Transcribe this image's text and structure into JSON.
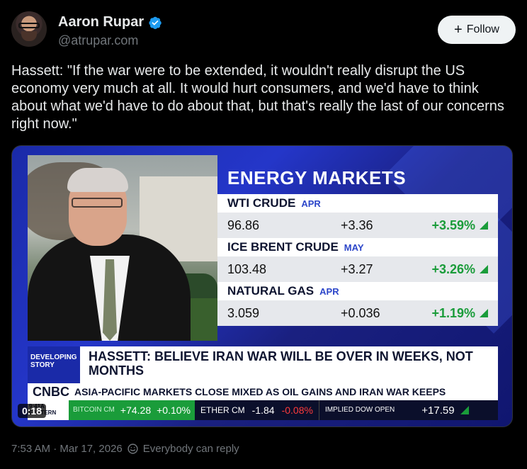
{
  "author": {
    "name": "Aaron Rupar",
    "handle": "@atrupar.com",
    "verified": true
  },
  "follow_button": {
    "label": "Follow",
    "icon": "plus-icon"
  },
  "post": {
    "text": "Hassett: \"If the war were to be extended, it wouldn't really disrupt the US economy very much at all. It would hurt consumers, and we'd have to think about what we'd have to do about that, but that's really the last of our concerns right now.\""
  },
  "video": {
    "duration": "0:18",
    "panel_title": "ENERGY MARKETS",
    "markets": [
      {
        "name": "WTI CRUDE",
        "month": "APR",
        "price": "96.86",
        "change": "+3.36",
        "pct": "+3.59%"
      },
      {
        "name": "ICE BRENT CRUDE",
        "month": "MAY",
        "price": "103.48",
        "change": "+3.27",
        "pct": "+3.26%"
      },
      {
        "name": "NATURAL GAS",
        "month": "APR",
        "price": "3.059",
        "change": "+0.036",
        "pct": "+1.19%"
      }
    ],
    "tag": "DEVELOPING STORY",
    "headline": "HASSETT: BELIEVE IRAN WAR WILL BE OVER IN WEEKS, NOT MONTHS",
    "network": "CNBC",
    "ticker": "ASIA-PACIFIC MARKETS CLOSE MIXED AS OIL GAINS AND IRAN WAR KEEPS",
    "corner": "9:41A EASTERN",
    "quotes": {
      "btc_label": "BITCOIN CM",
      "btc_change": "+74.28",
      "btc_pct": "+0.10%",
      "eth_label": "ETHER CM",
      "eth_change": "-1.84",
      "eth_pct": "-0.08%",
      "dow_label": "IMPLIED DOW OPEN",
      "dow_change": "+17.59"
    }
  },
  "meta": {
    "timestamp": "7:53 AM · Mar 17, 2026",
    "reply_setting": "Everybody can reply"
  },
  "colors": {
    "background": "#000000",
    "verified_blue": "#1d9bf0",
    "gain_green": "#1a9c3a",
    "loss_red": "#ff3b3b"
  }
}
